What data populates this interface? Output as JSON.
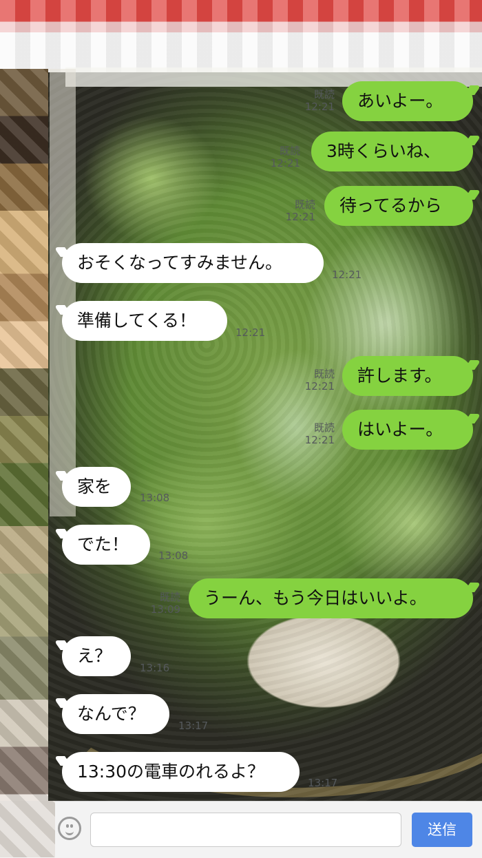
{
  "messages": [
    {
      "dir": "out",
      "text": "あいよー。",
      "read": "既読",
      "time": "12:21"
    },
    {
      "dir": "out",
      "text": "3時くらいね、",
      "read": "既読",
      "time": "12:21"
    },
    {
      "dir": "out",
      "text": "待ってるから",
      "read": "既読",
      "time": "12:21"
    },
    {
      "dir": "in",
      "text": "おそくなってすみません。",
      "time": "12:21"
    },
    {
      "dir": "in",
      "text": "準備してくる！",
      "time": "12:21"
    },
    {
      "dir": "out",
      "text": "許します。",
      "read": "既読",
      "time": "12:21"
    },
    {
      "dir": "out",
      "text": "はいよー。",
      "read": "既読",
      "time": "12:21"
    },
    {
      "dir": "in",
      "text": "家を",
      "time": "13:08"
    },
    {
      "dir": "in",
      "text": "でた！",
      "time": "13:08"
    },
    {
      "dir": "out",
      "text": "うーん、もう今日はいいよ。",
      "read": "既読",
      "time": "13:09"
    },
    {
      "dir": "in",
      "text": "え？",
      "time": "13:16"
    },
    {
      "dir": "in",
      "text": "なんで？",
      "time": "13:17"
    },
    {
      "dir": "in",
      "text": "13:30の電車のれるよ？",
      "time": "13:17"
    }
  ],
  "footer": {
    "input_placeholder": "",
    "send_label": "送信",
    "emoji_icon": "smiley-icon"
  },
  "colors": {
    "outgoing": "#85d240",
    "incoming": "#ffffff",
    "send_button": "#4e86e6"
  }
}
